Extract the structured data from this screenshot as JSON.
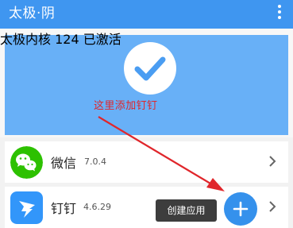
{
  "appbar": {
    "title": "太极·阴",
    "menu_icon": "more-vertical-icon"
  },
  "banner": {
    "status_icon": "check-circle-icon",
    "status_text": "太极内核 124 已激活"
  },
  "annotation": {
    "text": "这里添加钉钉",
    "color": "#e0262b"
  },
  "apps": [
    {
      "name": "微信",
      "version": "7.0.4",
      "icon": "wechat-icon"
    },
    {
      "name": "钉钉",
      "version": "4.6.29",
      "icon": "dingtalk-icon"
    }
  ],
  "fab": {
    "tooltip": "创建应用",
    "icon": "plus-icon"
  },
  "colors": {
    "accent": "#3f96f0",
    "banner": "#68b0f7",
    "wechat": "#2dc100",
    "dingtalk": "#3296fa"
  }
}
